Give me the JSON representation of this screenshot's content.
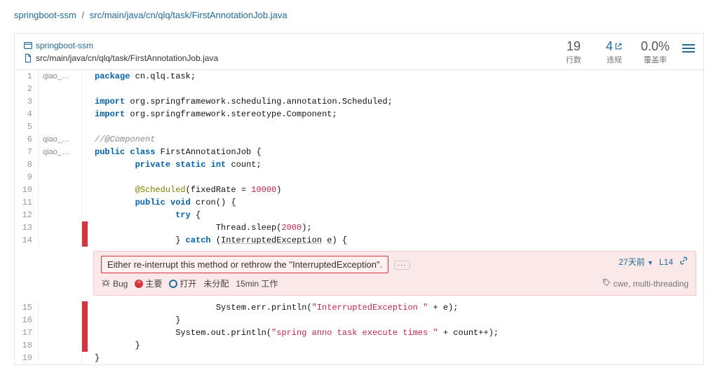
{
  "breadcrumb": {
    "project": "springboot-ssm",
    "sep": "/",
    "path": "src/main/java/cn/qlq/task/FirstAnnotationJob.java"
  },
  "header": {
    "project_link": "springboot-ssm",
    "file_path": "src/main/java/cn/qlq/task/FirstAnnotationJob.java"
  },
  "metrics": {
    "lines": {
      "value": "19",
      "label": "行数"
    },
    "issues": {
      "value": "4",
      "label": "违规"
    },
    "coverage": {
      "value": "0.0%",
      "label": "覆盖率"
    }
  },
  "code": {
    "lines": [
      {
        "n": "1",
        "author": "qiao_…",
        "html": "<span class='kw'>package</span> cn.qlq.task;"
      },
      {
        "n": "2",
        "author": "",
        "html": ""
      },
      {
        "n": "3",
        "author": "",
        "html": "<span class='kw'>import</span> org.springframework.scheduling.annotation.Scheduled;"
      },
      {
        "n": "4",
        "author": "",
        "html": "<span class='kw'>import</span> org.springframework.stereotype.Component;"
      },
      {
        "n": "5",
        "author": "",
        "html": ""
      },
      {
        "n": "6",
        "author": "qiao_…",
        "html": "<span class='cm'>//@Component</span>"
      },
      {
        "n": "7",
        "author": "qiao_…",
        "html": "<span class='kw'>public</span> <span class='kw'>class</span> FirstAnnotationJob {"
      },
      {
        "n": "8",
        "author": "",
        "html": "        <span class='kw'>private</span> <span class='kw'>static</span> <span class='kw'>int</span> count;"
      },
      {
        "n": "9",
        "author": "",
        "html": ""
      },
      {
        "n": "10",
        "author": "",
        "html": "        <span class='ann'>@Scheduled</span>(fixedRate = <span class='num'>10000</span>)"
      },
      {
        "n": "11",
        "author": "",
        "html": "        <span class='kw'>public</span> <span class='kw'>void</span> cron() {"
      },
      {
        "n": "12",
        "author": "",
        "html": "                <span class='kw'>try</span> {"
      },
      {
        "n": "13",
        "author": "",
        "html": "                        Thread.sleep(<span class='num'>2000</span>);",
        "issue": true
      },
      {
        "n": "14",
        "author": "",
        "html": "                } <span class='kw'>catch</span> (<span class='dim'>InterruptedException</span> <span class='dim'>e</span>) {",
        "issue": true
      }
    ],
    "lines_after": [
      {
        "n": "15",
        "author": "",
        "html": "                        System.err.println(<span class='s'>\"InterruptedException \"</span> + e);",
        "issue": true
      },
      {
        "n": "16",
        "author": "",
        "html": "                }",
        "issue": true
      },
      {
        "n": "17",
        "author": "",
        "html": "                System.out.println(<span class='s'>\"spring anno task execute times \"</span> + count++);",
        "issue": true
      },
      {
        "n": "18",
        "author": "",
        "html": "        }",
        "issue": true
      },
      {
        "n": "19",
        "author": "",
        "html": "}",
        "issue": false
      }
    ]
  },
  "issue": {
    "message": "Either re-interrupt this method or rethrow the \"InterruptedException\".",
    "comments_btn": "···",
    "age": "27天前",
    "line_link": "L14",
    "type_label": "Bug",
    "severity_label": "主要",
    "status_label": "打开",
    "assignee_label": "未分配",
    "effort_label": "15min 工作",
    "tags": "cwe, multi-threading"
  }
}
